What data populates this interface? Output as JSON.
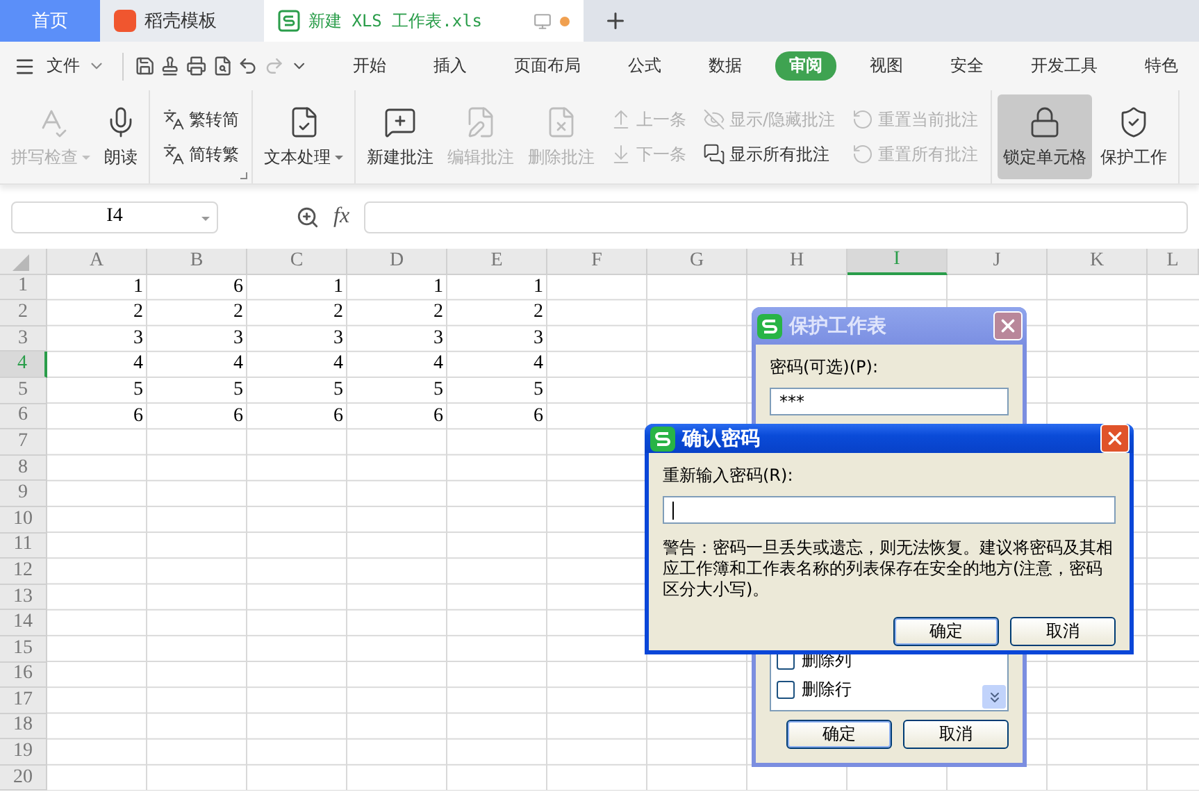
{
  "tabs": [
    {
      "label": "首页",
      "kind": "home",
      "selected": false
    },
    {
      "label": "稻壳模板",
      "kind": "app",
      "selected": false
    },
    {
      "label": "新建 XLS 工作表.xls",
      "kind": "file",
      "selected": true,
      "unsaved": true
    }
  ],
  "menu": {
    "file": "文件",
    "ribbon_tabs": [
      {
        "label": "开始",
        "selected": false
      },
      {
        "label": "插入",
        "selected": false
      },
      {
        "label": "页面布局",
        "selected": false
      },
      {
        "label": "公式",
        "selected": false
      },
      {
        "label": "数据",
        "selected": false
      },
      {
        "label": "审阅",
        "selected": true
      },
      {
        "label": "视图",
        "selected": false
      },
      {
        "label": "安全",
        "selected": false
      },
      {
        "label": "开发工具",
        "selected": false
      },
      {
        "label": "特色",
        "selected": false
      }
    ]
  },
  "ribbon": {
    "groups": [
      {
        "items": [
          {
            "kind": "large",
            "label": "拼写检查",
            "disabled": true,
            "dropdown": true,
            "selected": false
          },
          {
            "kind": "large",
            "label": "朗读",
            "disabled": false,
            "dropdown": false,
            "selected": false
          }
        ]
      },
      {
        "launcher": true,
        "items": [
          {
            "kind": "stack",
            "items": [
              {
                "label": "繁转简",
                "disabled": false
              },
              {
                "label": "简转繁",
                "disabled": false
              }
            ]
          }
        ]
      },
      {
        "items": [
          {
            "kind": "large",
            "label": "文本处理",
            "disabled": false,
            "dropdown": true,
            "selected": false
          }
        ]
      },
      {
        "items": [
          {
            "kind": "large",
            "label": "新建批注",
            "disabled": false,
            "dropdown": false,
            "selected": false
          },
          {
            "kind": "large",
            "label": "编辑批注",
            "disabled": true,
            "dropdown": false,
            "selected": false
          },
          {
            "kind": "large",
            "label": "删除批注",
            "disabled": true,
            "dropdown": false,
            "selected": false
          },
          {
            "kind": "stack",
            "items": [
              {
                "label": "上一条",
                "disabled": true
              },
              {
                "label": "下一条",
                "disabled": true
              }
            ]
          },
          {
            "kind": "stack",
            "items": [
              {
                "label": "显示/隐藏批注",
                "disabled": true
              },
              {
                "label": "显示所有批注",
                "disabled": false
              }
            ]
          },
          {
            "kind": "stack",
            "items": [
              {
                "label": "重置当前批注",
                "disabled": true
              },
              {
                "label": "重置所有批注",
                "disabled": true
              }
            ]
          }
        ]
      },
      {
        "items": [
          {
            "kind": "large",
            "label": "锁定单元格",
            "disabled": false,
            "dropdown": false,
            "selected": true
          },
          {
            "kind": "large",
            "label": "保护工作",
            "disabled": false,
            "dropdown": false,
            "selected": false
          }
        ]
      }
    ]
  },
  "formula_bar": {
    "cell": "I4",
    "fx": "fx"
  },
  "sheet": {
    "columns": [
      {
        "label": "A",
        "selected": false
      },
      {
        "label": "B",
        "selected": false
      },
      {
        "label": "C",
        "selected": false
      },
      {
        "label": "D",
        "selected": false
      },
      {
        "label": "E",
        "selected": false
      },
      {
        "label": "F",
        "selected": false
      },
      {
        "label": "G",
        "selected": false
      },
      {
        "label": "H",
        "selected": false
      },
      {
        "label": "I",
        "selected": true
      },
      {
        "label": "J",
        "selected": false
      },
      {
        "label": "K",
        "selected": false
      },
      {
        "label": "L",
        "selected": false
      }
    ],
    "rows": [
      {
        "label": "1",
        "selected": false,
        "cells": [
          "1",
          "6",
          "1",
          "1",
          "1"
        ]
      },
      {
        "label": "2",
        "selected": false,
        "cells": [
          "2",
          "2",
          "2",
          "2",
          "2"
        ]
      },
      {
        "label": "3",
        "selected": false,
        "cells": [
          "3",
          "3",
          "3",
          "3",
          "3"
        ]
      },
      {
        "label": "4",
        "selected": true,
        "cells": [
          "4",
          "4",
          "4",
          "4",
          "4"
        ]
      },
      {
        "label": "5",
        "selected": false,
        "cells": [
          "5",
          "5",
          "5",
          "5",
          "5"
        ]
      },
      {
        "label": "6",
        "selected": false,
        "cells": [
          "6",
          "6",
          "6",
          "6",
          "6"
        ]
      },
      {
        "label": "7",
        "selected": false
      },
      {
        "label": "8",
        "selected": false
      },
      {
        "label": "9",
        "selected": false
      },
      {
        "label": "10",
        "selected": false
      },
      {
        "label": "11",
        "selected": false
      },
      {
        "label": "12",
        "selected": false
      },
      {
        "label": "13",
        "selected": false
      },
      {
        "label": "14",
        "selected": false
      },
      {
        "label": "15",
        "selected": false
      },
      {
        "label": "16",
        "selected": false
      },
      {
        "label": "17",
        "selected": false
      },
      {
        "label": "18",
        "selected": false
      },
      {
        "label": "19",
        "selected": false
      },
      {
        "label": "20",
        "selected": false
      }
    ]
  },
  "protect_dialog": {
    "title": "保护工作表",
    "active": false,
    "password_label": "密码(可选)(P):",
    "password": "***",
    "options": [
      {
        "label": "删除列",
        "checked": false
      },
      {
        "label": "删除行",
        "checked": false
      }
    ],
    "buttons": [
      {
        "label": "确定",
        "default": true
      },
      {
        "label": "取消",
        "default": false
      }
    ]
  },
  "confirm_dialog": {
    "title": "确认密码",
    "active": true,
    "label": "重新输入密码(R):",
    "focused": true,
    "warning": "警告：密码一旦丢失或遗忘，则无法恢复。建议将密码及其相应工作簿和工作表名称的列表保存在安全的地方(注意，密码区分大小写)。",
    "buttons": [
      {
        "label": "确定",
        "default": true
      },
      {
        "label": "取消",
        "default": false
      }
    ]
  }
}
